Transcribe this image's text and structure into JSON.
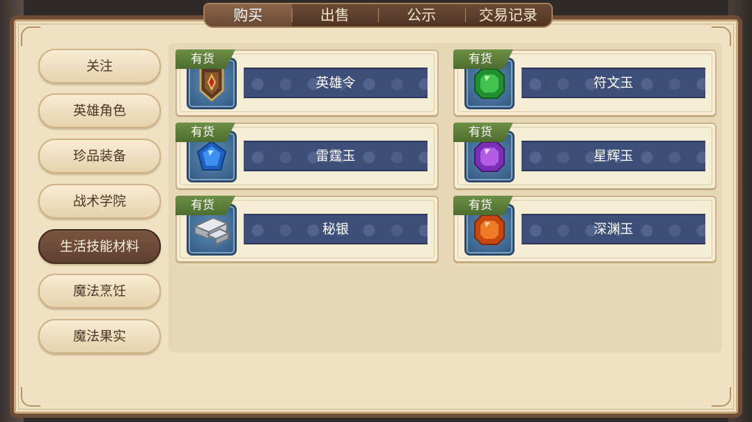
{
  "tabs": [
    {
      "label": "购买",
      "active": true
    },
    {
      "label": "出售",
      "active": false
    },
    {
      "label": "公示",
      "active": false
    },
    {
      "label": "交易记录",
      "active": false
    }
  ],
  "sidebar": {
    "items": [
      {
        "label": "关注",
        "active": false
      },
      {
        "label": "英雄角色",
        "active": false
      },
      {
        "label": "珍品装备",
        "active": false
      },
      {
        "label": "战术学院",
        "active": false
      },
      {
        "label": "生活技能材料",
        "active": true
      },
      {
        "label": "魔法烹饪",
        "active": false
      },
      {
        "label": "魔法果实",
        "active": false
      }
    ]
  },
  "items": [
    {
      "name": "英雄令",
      "badge": "有货",
      "icon": "hero-token-icon"
    },
    {
      "name": "符文玉",
      "badge": "有货",
      "icon": "green-gem-icon"
    },
    {
      "name": "雷霆玉",
      "badge": "有货",
      "icon": "blue-gem-icon"
    },
    {
      "name": "星辉玉",
      "badge": "有货",
      "icon": "purple-gem-icon"
    },
    {
      "name": "秘银",
      "badge": "有货",
      "icon": "silver-ingot-icon"
    },
    {
      "name": "深渊玉",
      "badge": "有货",
      "icon": "orange-gem-icon"
    }
  ],
  "colors": {
    "panel_bg": "#eee2c2",
    "frame_brown": "#6e4d35",
    "active_tab": "#7a5642",
    "badge_green": "#5d7f3c",
    "name_bar_blue": "#3d4f78"
  }
}
